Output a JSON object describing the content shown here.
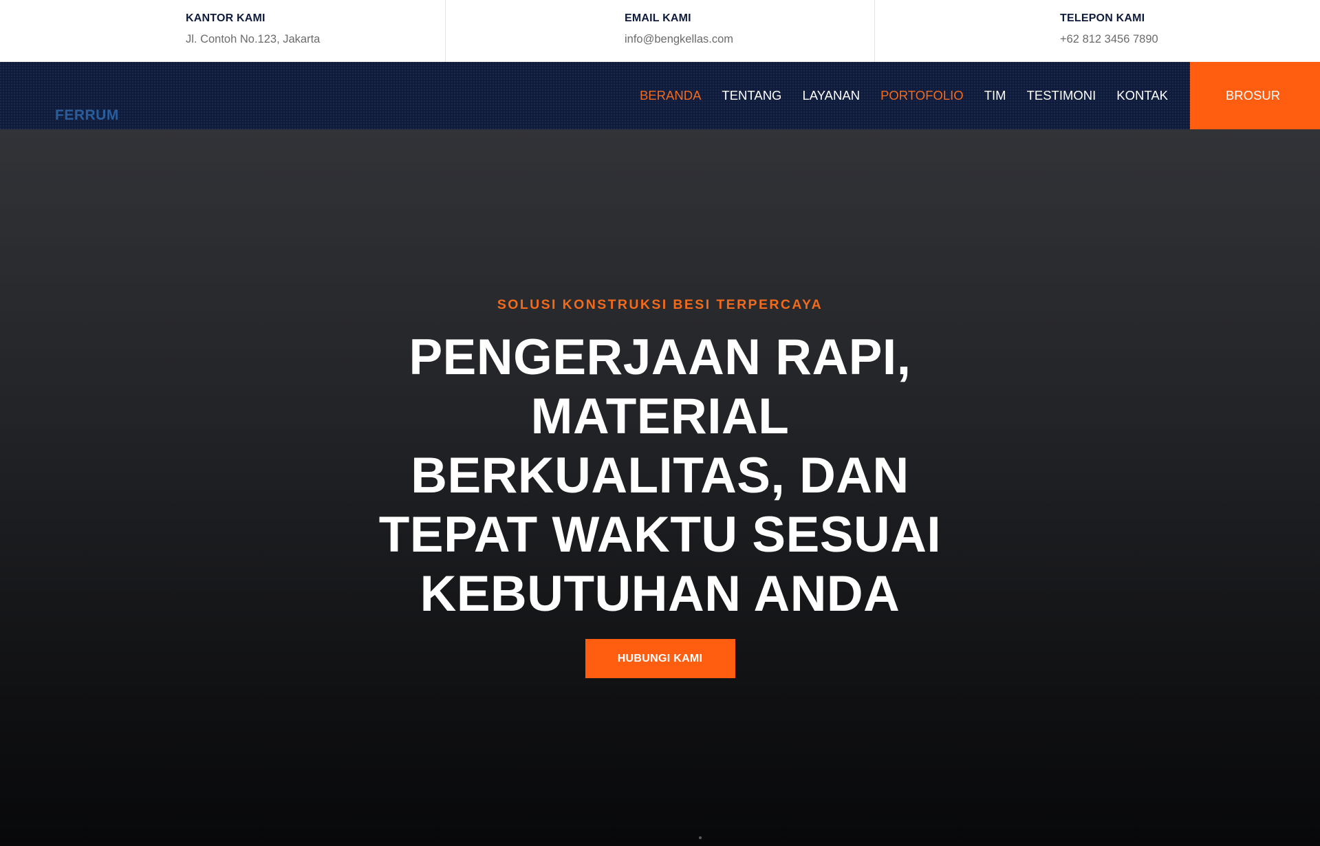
{
  "contact": [
    {
      "title": "KANTOR KAMI",
      "value": "Jl. Contoh No.123, Jakarta",
      "icon": "map-pin-icon"
    },
    {
      "title": "EMAIL KAMI",
      "value": "info@bengkellas.com",
      "icon": "envelope-icon"
    },
    {
      "title": "TELEPON KAMI",
      "value": "+62 812 3456 7890",
      "icon": "phone-vibrate-icon"
    }
  ],
  "brand": {
    "name": "FERRUM"
  },
  "nav": {
    "items": [
      "BERANDA",
      "TENTANG",
      "LAYANAN",
      "PORTOFOLIO",
      "TIM",
      "TESTIMONI",
      "KONTAK"
    ],
    "active": [
      "BERANDA",
      "PORTOFOLIO"
    ],
    "cta": "BROSUR"
  },
  "hero": {
    "subtitle": "SOLUSI KONSTRUKSI BESI TERPERCAYA",
    "headline": "PENGERJAAN RAPI, MATERIAL BERKUALITAS, DAN TEPAT WAKTU SESUAI KEBUTUHAN ANDA",
    "button": "HUBUNGI KAMI"
  },
  "colors": {
    "accent": "#ff5d10",
    "navy": "#0f1b3c",
    "brand_blue": "#2a5d9c"
  }
}
